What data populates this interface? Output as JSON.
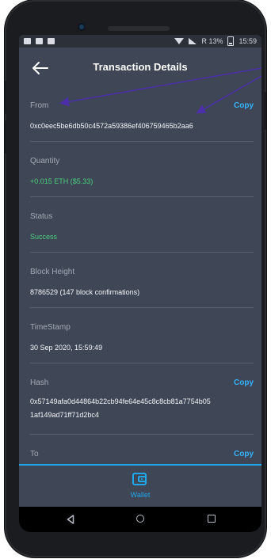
{
  "status_bar": {
    "battery_text": "R 13%",
    "time": "15:59"
  },
  "header": {
    "title": "Transaction Details"
  },
  "from": {
    "label": "From",
    "value": "0xc0eec5be6db50c4572a59386ef406759465b2aa6",
    "copy_label": "Copy"
  },
  "quantity": {
    "label": "Quantity",
    "value": "+0.015 ETH ($5.33)"
  },
  "status": {
    "label": "Status",
    "value": "Success"
  },
  "block_height": {
    "label": "Block Height",
    "value": "8786529 (147 block confirmations)"
  },
  "timestamp": {
    "label": "TimeStamp",
    "value": "30 Sep 2020, 15:59:49"
  },
  "hash": {
    "label": "Hash",
    "value_line1": "0x57149afa0d44864b22cb94fe64e45c8c8cb81a7754b05",
    "value_line2": "1af149ad71ff71d2bc4",
    "copy_label": "Copy"
  },
  "to": {
    "label": "To",
    "copy_label": "Copy"
  },
  "bottom_nav": {
    "wallet_label": "Wallet"
  },
  "colors": {
    "background": "#3f4655",
    "accent": "#1fa8ee",
    "copy": "#35b3ff",
    "success": "#4ad07f",
    "annotation": "#4b2fa8"
  },
  "icons": {
    "back": "arrow-left-icon",
    "wallet": "wallet-icon",
    "nav_back": "triangle-left-icon",
    "nav_home": "circle-icon",
    "nav_recent": "square-icon"
  }
}
